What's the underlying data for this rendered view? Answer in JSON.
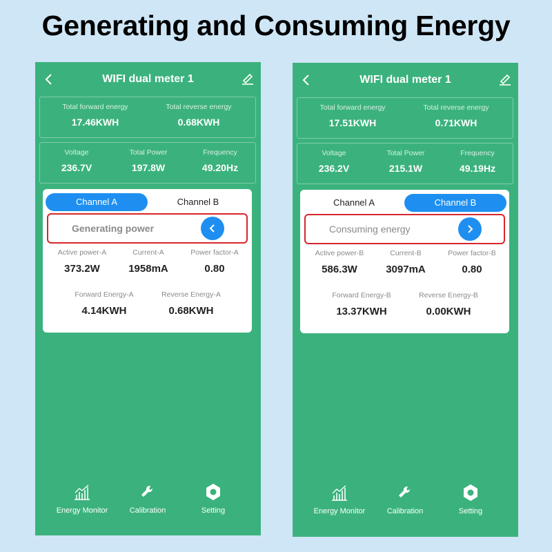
{
  "headline": "Generating and Consuming Energy",
  "phones": [
    {
      "title": "WIFI dual meter 1",
      "totals": [
        {
          "label": "Total  forward energy",
          "value": "17.46KWH"
        },
        {
          "label": "Total reverse energy",
          "value": "0.68KWH"
        }
      ],
      "summary": [
        {
          "label": "Voltage",
          "value": "236.7V"
        },
        {
          "label": "Total Power",
          "value": "197.8W"
        },
        {
          "label": "Frequency",
          "value": "49.20Hz"
        }
      ],
      "tabs": [
        "Channel A",
        "Channel B"
      ],
      "active_tab": "Channel A",
      "mode_label": "Generating power",
      "mode_arrow": "chevron-left",
      "metrics_row1": [
        {
          "label": "Active power-A",
          "value": "373.2W"
        },
        {
          "label": "Current-A",
          "value": "1958mA"
        },
        {
          "label": "Power factor-A",
          "value": "0.80"
        }
      ],
      "metrics_row2": [
        {
          "label": "Forward Energy-A",
          "value": "4.14KWH"
        },
        {
          "label": "Reverse Energy-A",
          "value": "0.68KWH"
        }
      ],
      "nav": [
        "Energy Monitor",
        "Calibration",
        "Setting"
      ]
    },
    {
      "title": "WIFI dual meter 1",
      "totals": [
        {
          "label": "Total  forward energy",
          "value": "17.51KWH"
        },
        {
          "label": "Total reverse energy",
          "value": "0.71KWH"
        }
      ],
      "summary": [
        {
          "label": "Voltage",
          "value": "236.2V"
        },
        {
          "label": "Total Power",
          "value": "215.1W"
        },
        {
          "label": "Frequency",
          "value": "49.19Hz"
        }
      ],
      "tabs": [
        "Channel A",
        "Channel B"
      ],
      "active_tab": "Channel B",
      "mode_label": "Consuming energy",
      "mode_arrow": "chevron-right",
      "metrics_row1": [
        {
          "label": "Active power-B",
          "value": "586.3W"
        },
        {
          "label": "Current-B",
          "value": "3097mA"
        },
        {
          "label": "Power factor-B",
          "value": "0.80"
        }
      ],
      "metrics_row2": [
        {
          "label": "Forward Energy-B",
          "value": "13.37KWH"
        },
        {
          "label": "Reverse Energy-B",
          "value": "0.00KWH"
        }
      ],
      "nav": [
        "Energy Monitor",
        "Calibration",
        "Setting"
      ]
    }
  ],
  "colors": {
    "background": "#cfe6f6",
    "app_green": "#3bb27d",
    "accent_blue": "#1e8ff0",
    "highlight_red": "#d7252b"
  },
  "icons": {
    "back": "chevron-left-icon",
    "edit": "edit-pencil-icon",
    "nav": [
      "chart-icon",
      "wrench-icon",
      "hexagon-gear-icon"
    ]
  }
}
